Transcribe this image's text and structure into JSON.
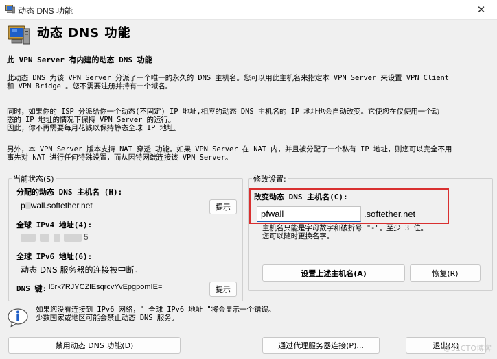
{
  "window": {
    "title": "动态 DNS 功能",
    "close_glyph": "✕"
  },
  "header": {
    "title": "动态 DNS 功能"
  },
  "section": {
    "title": "此 VPN Server 有内建的动态 DNS 功能"
  },
  "paragraphs": [
    "此动态 DNS 为该 VPN Server 分派了一个唯一的永久的 DNS 主机名。您可以用此主机名来指定本 VPN Server 来设置 VPN Client\n和 VPN Bridge 。您不需要注册并持有一个域名。",
    "同时，如果你的 ISP 分派给你一个动态(不固定) IP 地址,相应的动态 DNS 主机名的 IP 地址也会自动改变。它使您在仅使用一个动\n态的 IP 地址的情况下保持 VPN Server 的运行。\n因此，你不再需要每月花钱以保持静态全球 IP 地址。",
    "另外，本 VPN Server 版本支持 NAT 穿透 功能。如果 VPN Server 在 NAT 内，并且被分配了一个私有 IP 地址，则您可以完全不用\n事先对 NAT 进行任何特殊设置，而从因特网端连接该 VPN Server。"
  ],
  "status": {
    "legend": "当前状态(S)",
    "hostname_label": "分配的动态 DNS 主机名 (H):",
    "hostname_prefix": "p",
    "hostname_suffix": "wall.softether.net",
    "ipv4_label": "全球 IPv4 地址(4):",
    "ipv4_tail": "5",
    "ipv6_label": "全球 IPv6 地址(6):",
    "ipv6_value": "动态 DNS 服务器的连接被中断。",
    "key_label": "DNS 键:",
    "key_value": "l5rk7RJYCZlEsqrcvYvEpgpomIE=",
    "hint_button": "提示"
  },
  "modify": {
    "legend": "修改设置:",
    "label": "改变动态 DNS 主机名(C):",
    "input_value": "pfwall",
    "suffix": ".softether.net",
    "note": "主机名只能是字母数字和破折号 \"-\"。至少 3 位。\n您可以随时更换名字。",
    "apply_button": "设置上述主机名(A)",
    "restore_button": "恢复(R)"
  },
  "info": {
    "text": "如果您没有连接到 IPv6 网络，\" 全球 IPv6 地址 \"将会显示一个错误。\n少数国家或地区可能会禁止动态 DNS 服务。"
  },
  "footer": {
    "disable_button": "禁用动态 DNS 功能(D)",
    "proxy_button": "通过代理服务器连接(P)...",
    "exit_button": "退出(X)"
  },
  "watermark": "@51CTO博客",
  "colors": {
    "highlight_border": "#d93030",
    "input_focus": "#1a5fb4"
  }
}
